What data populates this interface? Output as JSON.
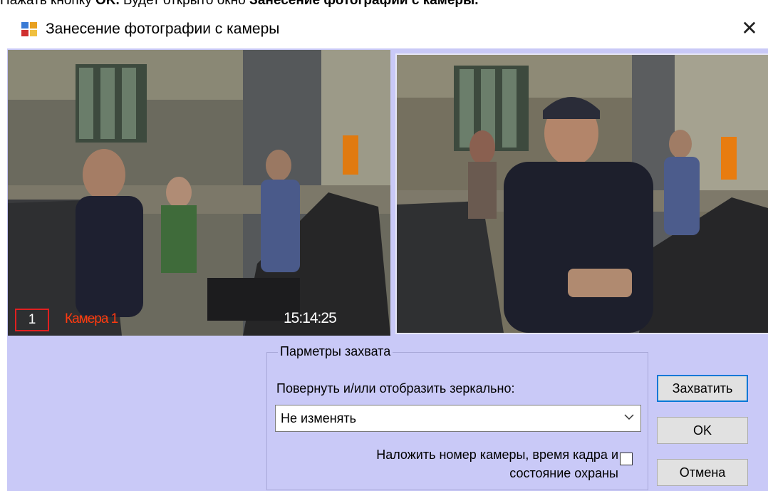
{
  "doc": {
    "pre": "Нажать кнопку ",
    "ok_bold": "OK.",
    "mid": " Будет открыто окно ",
    "window_bold": "Занесение фотографии с камеры."
  },
  "dialog": {
    "title": "Занесение фотографии с камеры",
    "close_glyph": "✕"
  },
  "left_video": {
    "camera_number": "1",
    "camera_name": "Камера 1",
    "time": "15:14:25"
  },
  "capture_params": {
    "legend": "Парметры захвата",
    "rotate_label": "Повернуть и/или отобразить зеркально:",
    "rotate_value": "Не изменять",
    "overlay_label_line1": "Наложить номер камеры, время кадра и",
    "overlay_label_line2": "состояние охраны",
    "overlay_checked": false
  },
  "buttons": {
    "capture": "Захватить",
    "ok": "OK",
    "cancel": "Отмена"
  },
  "colors": {
    "client_bg": "#c9c9f7",
    "osd_camera": "#ff3a10",
    "osd_border": "#e02020",
    "focus_border": "#0078d7"
  },
  "icons": {
    "app": "camera-app-icon",
    "close": "close-icon",
    "dropdown": "chevron-down-icon"
  }
}
